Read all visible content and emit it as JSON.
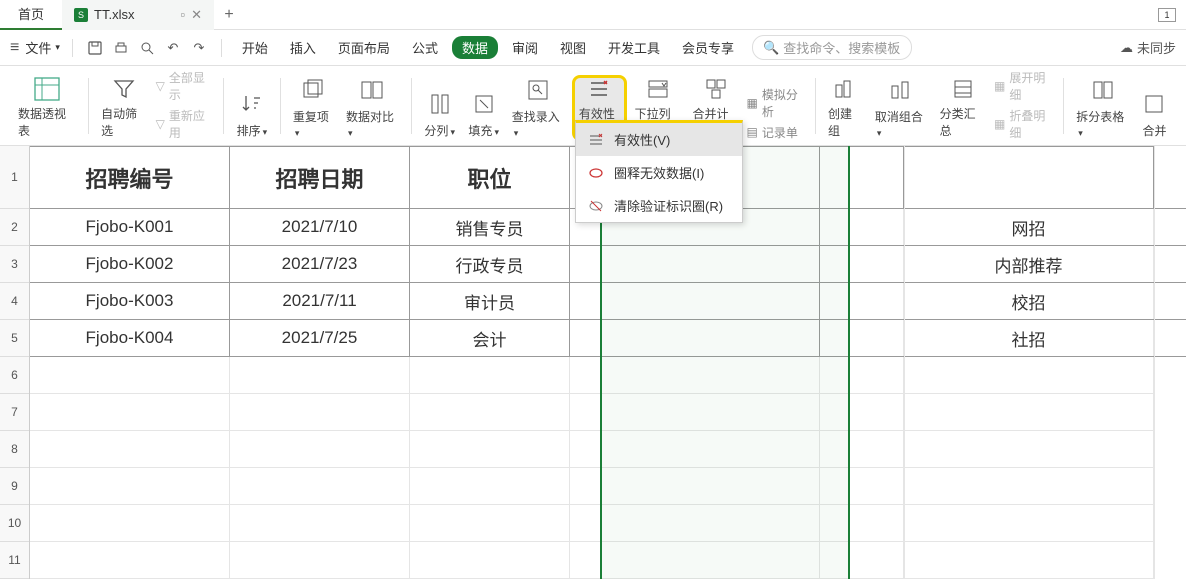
{
  "titlebar": {
    "home": "首页",
    "doc_name": "TT.xlsx",
    "win_index": "1"
  },
  "menubar": {
    "file": "文件",
    "tabs": [
      "开始",
      "插入",
      "页面布局",
      "公式",
      "数据",
      "审阅",
      "视图",
      "开发工具",
      "会员专享"
    ],
    "active_tab": "数据",
    "search_placeholder": "查找命令、搜索模板",
    "sync": "未同步"
  },
  "ribbon": {
    "pivot": "数据透视表",
    "autofilter": "自动筛选",
    "showall": "全部显示",
    "reapply": "重新应用",
    "sort": "排序",
    "dedup": "重复项",
    "compare": "数据对比",
    "split": "分列",
    "fill": "填充",
    "lookup": "查找录入",
    "validity": "有效性",
    "dropdown": "下拉列表",
    "consolidate": "合并计算",
    "simulate": "模拟分析",
    "record": "记录单",
    "group": "创建组",
    "ungroup": "取消组合",
    "subtotal": "分类汇总",
    "expand": "展开明细",
    "collapse": "折叠明细",
    "splittable": "拆分表格",
    "merge": "合并"
  },
  "dropdown_menu": {
    "validity": "有效性(V)",
    "circle": "圈释无效数据(I)",
    "clear": "清除验证标识圈(R)"
  },
  "table": {
    "headers": [
      "招聘编号",
      "招聘日期",
      "职位",
      "",
      "",
      "",
      ""
    ],
    "rows": [
      {
        "id": "Fjobo-K001",
        "date": "2021/7/10",
        "pos": "销售专员",
        "src": "网招"
      },
      {
        "id": "Fjobo-K002",
        "date": "2021/7/23",
        "pos": "行政专员",
        "src": "内部推荐"
      },
      {
        "id": "Fjobo-K003",
        "date": "2021/7/11",
        "pos": "审计员",
        "src": "校招"
      },
      {
        "id": "Fjobo-K004",
        "date": "2021/7/25",
        "pos": "会计",
        "src": "社招"
      }
    ]
  },
  "rowlabels": [
    "1",
    "2",
    "3",
    "4",
    "5",
    "6",
    "7",
    "8",
    "9",
    "10",
    "11"
  ]
}
